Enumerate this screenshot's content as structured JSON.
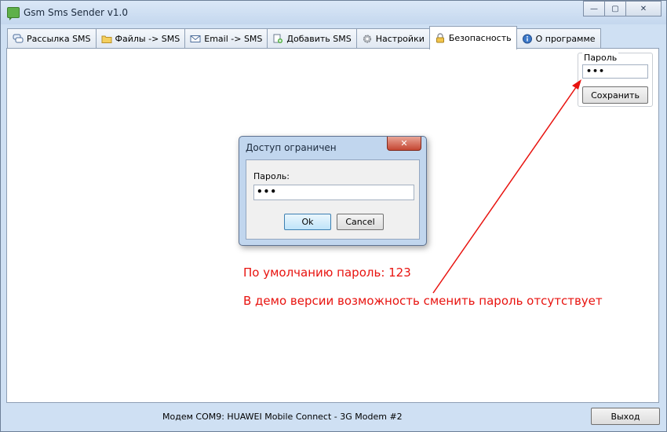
{
  "window": {
    "title": "Gsm Sms Sender v1.0",
    "minimize_glyph": "—",
    "maximize_glyph": "▢",
    "close_glyph": "✕"
  },
  "tabs": [
    {
      "label": "Рассылка SMS",
      "icon": "chat-bubbles-icon"
    },
    {
      "label": "Файлы -> SMS",
      "icon": "folder-icon"
    },
    {
      "label": "Email -> SMS",
      "icon": "envelope-icon"
    },
    {
      "label": "Добавить SMS",
      "icon": "add-document-icon"
    },
    {
      "label": "Настройки",
      "icon": "gear-icon"
    },
    {
      "label": "Безопасность",
      "icon": "lock-icon",
      "active": true
    },
    {
      "label": "О программе",
      "icon": "info-icon"
    }
  ],
  "security": {
    "password_legend": "Пароль",
    "password_value": "•••",
    "save_label": "Сохранить"
  },
  "dialog": {
    "title": "Доступ ограничен",
    "close_glyph": "✕",
    "password_label": "Пароль:",
    "password_value": "•••",
    "ok_label": "Ok",
    "cancel_label": "Cancel"
  },
  "notes": {
    "default_password": "По умолчанию пароль:  123",
    "demo_notice": "В демо версии возможность сменить пароль отсутствует",
    "color": "#e8130f"
  },
  "status": {
    "modem_text": "Модем COM9: HUAWEI Mobile Connect - 3G Modem #2",
    "exit_label": "Выход"
  }
}
